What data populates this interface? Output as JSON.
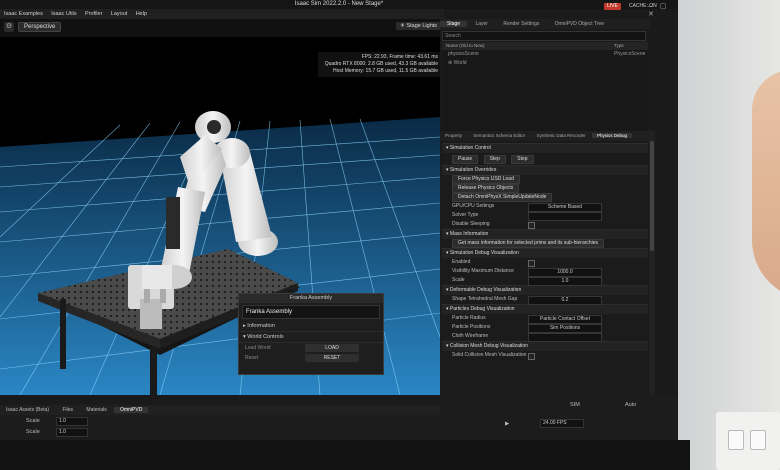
{
  "app": {
    "title": "Isaac Sim 2022.2.0 - New Stage*",
    "live_badge": "LIVE",
    "cache_label": "CACHE: ON"
  },
  "menu": [
    "Isaac Examples",
    "Isaac Utils",
    "Profiler",
    "Layout",
    "Help"
  ],
  "viewport": {
    "camera_label": "Perspective",
    "lights_label": "Stage Lights",
    "stats": [
      "FPS: 22.93, Frame time: 43.61 ms",
      "Quadro RTX 8000: 2.8 GB used, 43.3 GB available",
      "Host Memory: 15.7 GB used, 11.5 GB available"
    ]
  },
  "floating_property": {
    "header": "Franka Assembly",
    "name_value": "Franka Assembly",
    "section_information": "Information",
    "section_world_controls": "World Controls",
    "load_world_label": "Load World",
    "load_button": "LOAD",
    "reset_label": "Reset",
    "reset_button": "RESET"
  },
  "stage": {
    "tabs": [
      "Stage",
      "Layer",
      "Render Settings",
      "OmniPVD Object Tree"
    ],
    "search_placeholder": "Search",
    "col_name": "Name (Old to New)",
    "col_type": "Type",
    "rows": [
      {
        "name": "physicsScene",
        "type": "PhysicsScene"
      },
      {
        "name": "World",
        "type": ""
      }
    ]
  },
  "property_tabs": [
    "Property",
    "Semantics Schema Editor",
    "Synthetic Data Recorder",
    "Physics Debug"
  ],
  "physics_debug": {
    "simulation_control": {
      "title": "Simulation Control",
      "buttons": [
        "Pause",
        "Step",
        "Step"
      ]
    },
    "simulation_overrides": {
      "title": "Simulation Overrides",
      "force_load": "Force Physics USD Load",
      "release": "Release Physics Objects",
      "detach": "Detach OmniPhysX SimpleUpdateNode",
      "gpu_cpu_label": "GPU/CPU Settings",
      "gpu_cpu_value": "Scheme Based",
      "solver_type": "Solver Type",
      "disable_sleeping": "Disable Sleeping"
    },
    "mass_information": {
      "title": "Mass Information",
      "get_mass": "Get mass information for selected prims and its sub-hierarchies"
    },
    "debug_visualization": {
      "title": "Simulation Debug Visualization",
      "enabled": "Enabled",
      "visibility_label": "Visibility Maximum Distance",
      "visibility_value": "1000.0",
      "scale_label": "Scale",
      "scale_value": "1.0"
    },
    "deformable": {
      "title": "Deformable Debug Visualization",
      "shape_label": "Shape Tetrahedral Mesh Gap",
      "shape_value": "0.2"
    },
    "particles": {
      "title": "Particles Debug Visualization",
      "particle_radius": "Particle Radius",
      "particle_radius_value": "Particle Contact Offset",
      "particle_positions": "Particle Positions",
      "particle_positions_value": "Sim Positions",
      "cloth_wireframe": "Cloth Wireframe"
    },
    "collision_mesh": {
      "title": "Collision Mesh Debug Visualization",
      "solid": "Solid Collision Mesh Visualization"
    }
  },
  "bottom": {
    "tabs": [
      "Isaac Assets (Beta)",
      "Files",
      "Materials",
      "OmniPVD"
    ],
    "scale_label": "Scale",
    "scale_value_1": "1.0",
    "scale_value_2": "1.0",
    "fps_value": "24.00 FPS",
    "auto_label": "Auto",
    "sim_label": "SIM"
  },
  "colors": {
    "floor_tile": "#1f6fa8",
    "grid_line": "#7fd0ff",
    "live_badge": "#c0392b",
    "panel_bg": "#1b1b1b"
  }
}
